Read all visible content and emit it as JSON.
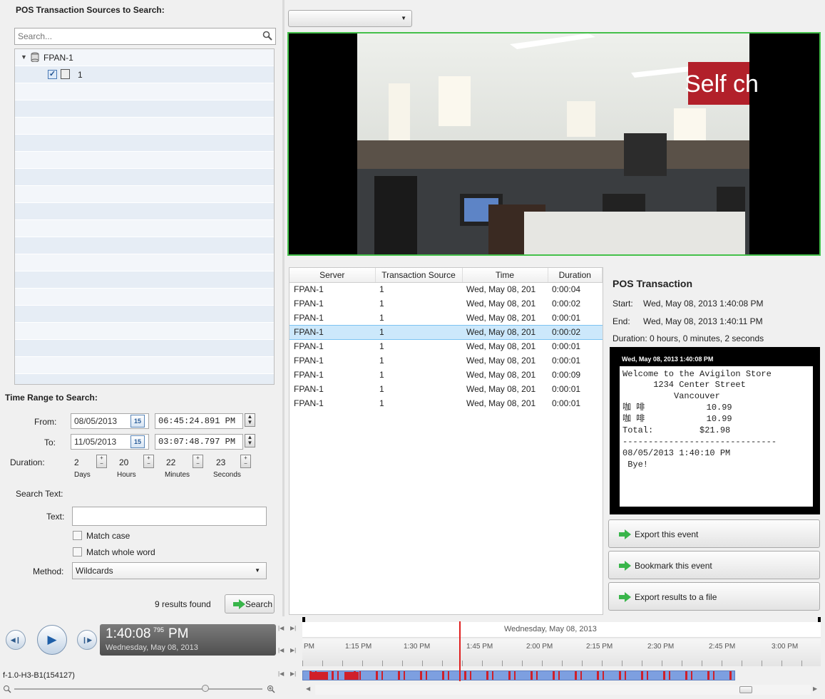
{
  "left": {
    "sources_title": "POS Transaction Sources to Search:",
    "search_placeholder": "Search...",
    "tree": {
      "server": "FPAN-1",
      "source": "1"
    },
    "time_range_title": "Time Range to Search:",
    "from_label": "From:",
    "from_date": "08/05/2013",
    "from_time": "06:45:24.891 PM",
    "to_label": "To:",
    "to_date": "11/05/2013",
    "to_time": "03:07:48.797 PM",
    "calendar_day": "15",
    "duration_label": "Duration:",
    "duration": [
      {
        "value": "2",
        "unit": "Days"
      },
      {
        "value": "20",
        "unit": "Hours"
      },
      {
        "value": "22",
        "unit": "Minutes"
      },
      {
        "value": "23",
        "unit": "Seconds"
      }
    ],
    "search_text_label": "Search Text:",
    "text_label": "Text:",
    "text_value": "",
    "match_case": "Match case",
    "match_whole_word": "Match whole word",
    "method_label": "Method:",
    "method_value": "Wildcards",
    "results": "9 results found",
    "search_button": "Search"
  },
  "player": {
    "time": "1:40:08",
    "ms": "795",
    "ampm": "PM",
    "date": "Wednesday, May 08, 2013",
    "camera_name": "f-1.0-H3-B1(154127)"
  },
  "table": {
    "columns": [
      "Server",
      "Transaction Source",
      "Time",
      "Duration"
    ],
    "rows": [
      [
        "FPAN-1",
        "1",
        "Wed, May 08, 201",
        "0:00:04"
      ],
      [
        "FPAN-1",
        "1",
        "Wed, May 08, 201",
        "0:00:02"
      ],
      [
        "FPAN-1",
        "1",
        "Wed, May 08, 201",
        "0:00:01"
      ],
      [
        "FPAN-1",
        "1",
        "Wed, May 08, 201",
        "0:00:02"
      ],
      [
        "FPAN-1",
        "1",
        "Wed, May 08, 201",
        "0:00:01"
      ],
      [
        "FPAN-1",
        "1",
        "Wed, May 08, 201",
        "0:00:01"
      ],
      [
        "FPAN-1",
        "1",
        "Wed, May 08, 201",
        "0:00:09"
      ],
      [
        "FPAN-1",
        "1",
        "Wed, May 08, 201",
        "0:00:01"
      ],
      [
        "FPAN-1",
        "1",
        "Wed, May 08, 201",
        "0:00:01"
      ]
    ],
    "selected_index": 3
  },
  "pos": {
    "title": "POS Transaction",
    "start_label": "Start:",
    "start_value": "Wed, May 08, 2013 1:40:08 PM",
    "end_label": "End:",
    "end_value": "Wed, May 08, 2013 1:40:11 PM",
    "duration_text": "Duration: 0 hours, 0 minutes, 2 seconds",
    "receipt_header": "Wed, May 08, 2013 1:40:08 PM",
    "receipt_lines": [
      "Welcome to the Avigilon Store",
      "      1234 Center Street",
      "          Vancouver",
      "咖 啡            10.99",
      "咖 啡            10.99",
      "Total:         $21.98",
      "------------------------------",
      "08/05/2013 1:40:10 PM",
      " Bye!"
    ],
    "export_event": "Export this event",
    "bookmark_event": "Bookmark this event",
    "export_results": "Export results to a file"
  },
  "video": {
    "sign_text": "Self ch"
  },
  "timeline": {
    "date": "Wednesday, May 08, 2013",
    "ticks": [
      "PM",
      "1:15 PM",
      "1:30 PM",
      "1:45 PM",
      "2:00 PM",
      "2:15 PM",
      "2:30 PM",
      "2:45 PM",
      "3:00 PM"
    ]
  },
  "colors": {
    "video_border": "#44c04a",
    "selection": "#cce8fb",
    "playhead": "#e02020",
    "timeline_bar": "#7d9fe0",
    "timeline_event": "#d0202a"
  }
}
